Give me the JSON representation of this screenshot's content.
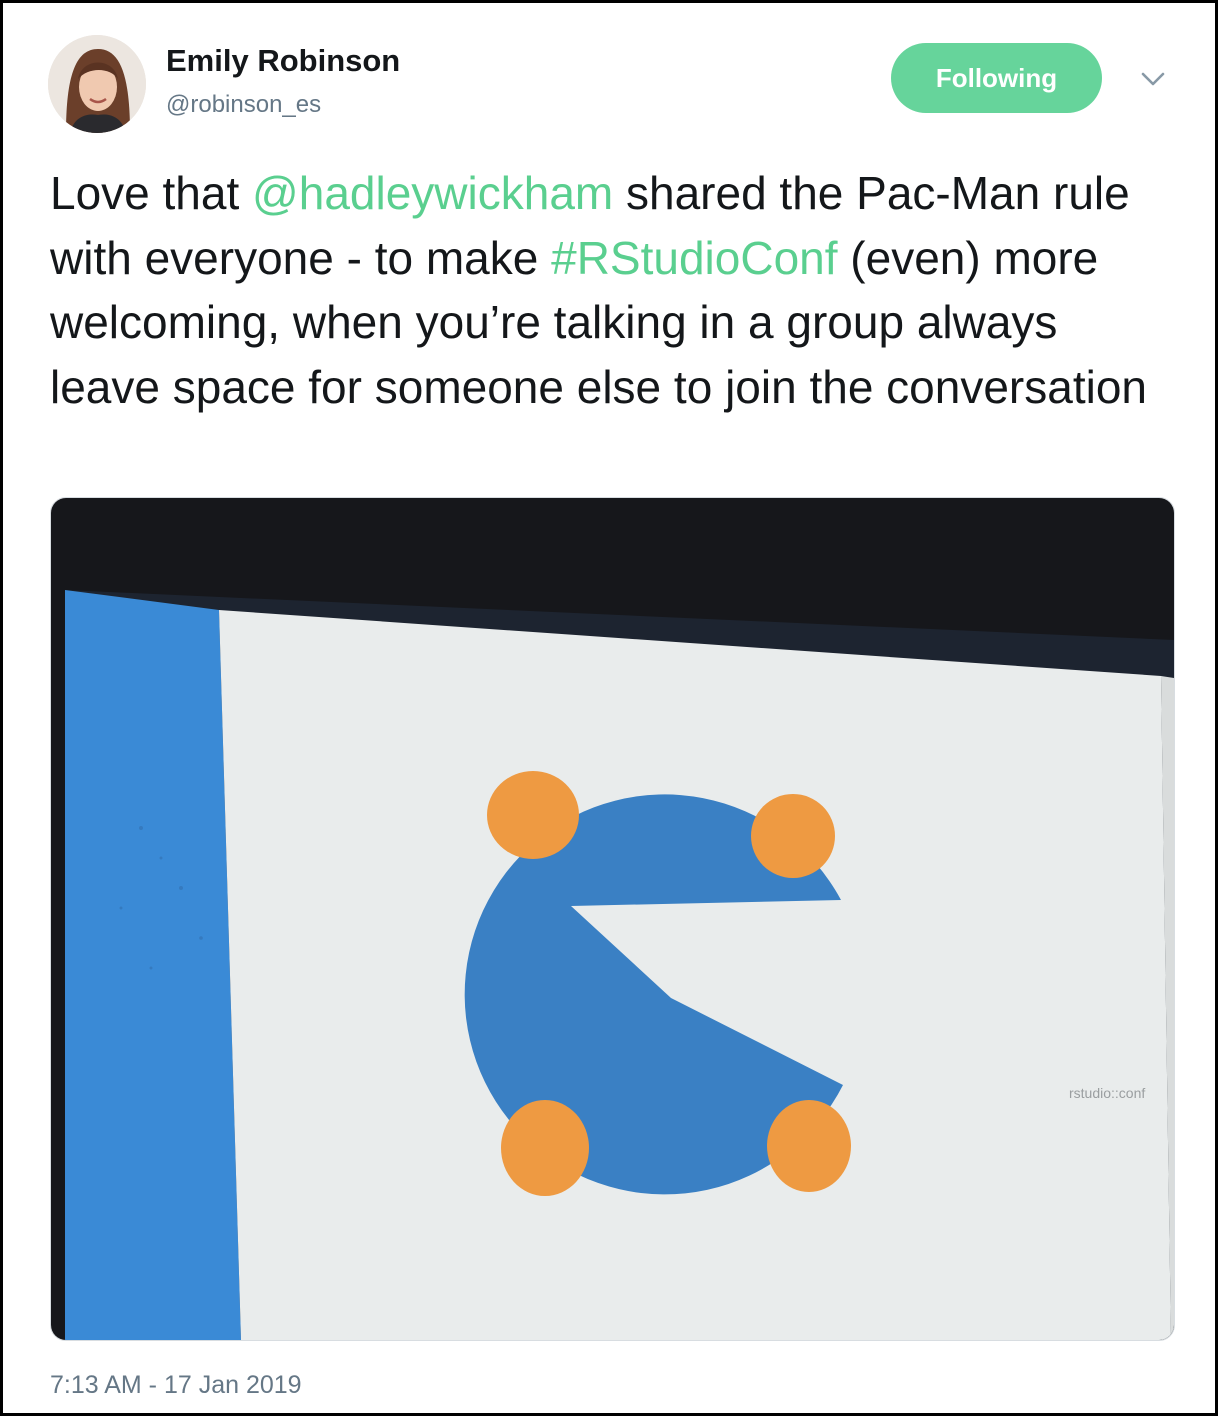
{
  "author": {
    "name": "Emily Robinson",
    "handle": "@robinson_es"
  },
  "follow_button": {
    "label": "Following"
  },
  "menu": {
    "icon": "chevron-down-icon"
  },
  "tweet": {
    "text_before": "Love that ",
    "mention": "@hadleywickham",
    "text_middle": " shared the Pac-Man rule with everyone - to make ",
    "hashtag": "#RStudioConf",
    "text_after": " (even) more welcoming, when you’re talking in a group always leave space for someone else to join the conversation",
    "timestamp": "7:13 AM - 17 Jan 2019"
  },
  "media": {
    "slide_watermark": "rstudio::conf"
  },
  "colors": {
    "accent": "#66d49b",
    "link": "#5acf8f",
    "pacman_blue": "#3a80c4",
    "dot_orange": "#ee9a42",
    "slide_bar_blue": "#3a8ad6"
  }
}
